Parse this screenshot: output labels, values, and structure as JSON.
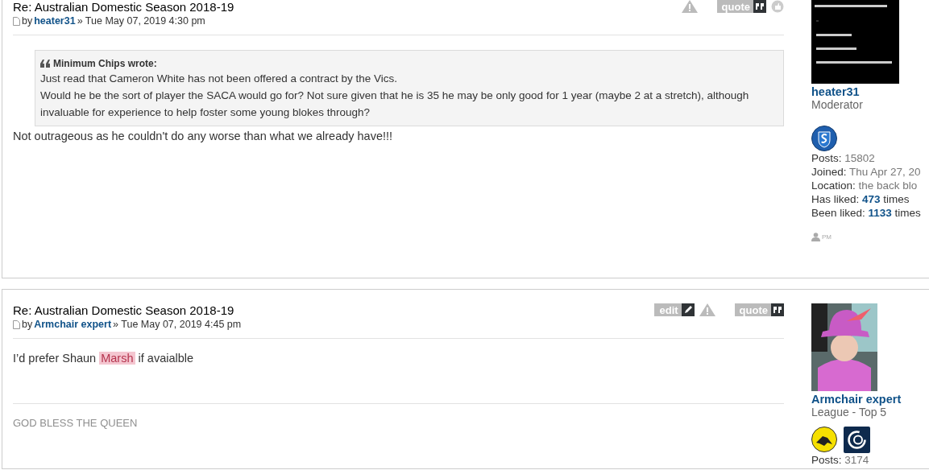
{
  "posts": [
    {
      "title": "Re: Australian Domestic Season 2018-19",
      "by": "by",
      "author": "heater31",
      "date": "» Tue May 07, 2019 4:30 pm",
      "actions": [
        {
          "kind": "report"
        },
        {
          "kind": "quote",
          "label": "quote"
        },
        {
          "kind": "like"
        }
      ],
      "quote": {
        "author": "Minimum Chips wrote:",
        "lines": [
          "Just read that Cameron White has not been offered a contract by the Vics.",
          "Would he be the sort of player the SACA would go for? Not sure given that he is 35 he may be only good for 1 year (maybe 2 at a stretch), although invaluable for experience to help foster some young blokes through?"
        ]
      },
      "body": [
        {
          "text": "Not outrageous as he couldn't do any worse than what we already have!!!",
          "highlighted": false
        }
      ],
      "profile": {
        "avatar": {
          "kind": "note"
        },
        "name": "heater31",
        "rank": "Moderator",
        "badges": [
          {
            "kind": "shield"
          }
        ],
        "stats": [
          {
            "label": "Posts:",
            "value": "15802",
            "strong": false
          },
          {
            "label": "Joined:",
            "value": "Thu Apr 27, 20",
            "strong": false
          },
          {
            "label": "Location:",
            "value": "the back blo",
            "strong": false
          },
          {
            "label": "Has liked:",
            "value": "473",
            "suffix": "times",
            "strong": true
          },
          {
            "label": "Been liked:",
            "value": "1133",
            "suffix": "times",
            "strong": true
          }
        ],
        "pm": "PM"
      }
    },
    {
      "title": "Re: Australian Domestic Season 2018-19",
      "by": "by",
      "author": "Armchair expert",
      "date": "» Tue May 07, 2019 4:45 pm",
      "actions": [
        {
          "kind": "edit",
          "label": "edit"
        },
        {
          "kind": "report"
        },
        {
          "kind": "quote",
          "label": "quote"
        }
      ],
      "body": [
        {
          "text": "I’d prefer Shaun ",
          "highlighted": false
        },
        {
          "text": "Marsh",
          "highlighted": true
        },
        {
          "text": " if avaialble",
          "highlighted": false
        }
      ],
      "signature": "GOD BLESS THE QUEEN",
      "profile": {
        "avatar": {
          "kind": "figure"
        },
        "name": "Armchair expert",
        "rank": "League - Top 5",
        "badges": [
          {
            "kind": "tiger"
          },
          {
            "kind": "monogram"
          }
        ],
        "stats": [
          {
            "label": "Posts:",
            "value": "3174",
            "strong": false
          }
        ]
      }
    }
  ]
}
